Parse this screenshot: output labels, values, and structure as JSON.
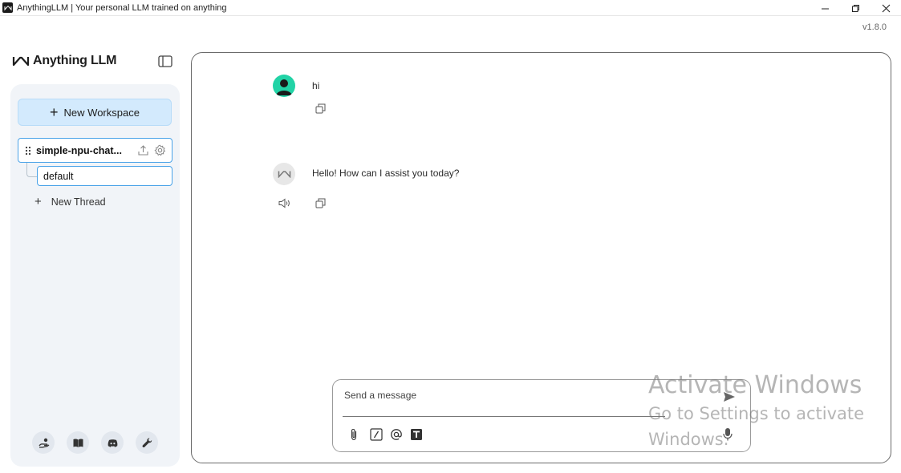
{
  "window": {
    "title": "AnythingLLM | Your personal LLM trained on anything",
    "version": "v1.8.0"
  },
  "brand": {
    "name": "Anything LLM"
  },
  "sidebar": {
    "new_workspace_label": "New Workspace",
    "workspace": {
      "name": "simple-npu-chat..."
    },
    "threads": [
      {
        "label": "default"
      }
    ],
    "new_thread_label": "New Thread",
    "footer_icons": [
      "community-hub-icon",
      "docs-book-icon",
      "discord-icon",
      "settings-wrench-icon"
    ]
  },
  "chat": {
    "messages": [
      {
        "role": "user",
        "text": "hi"
      },
      {
        "role": "assistant",
        "text": "Hello! How can I assist you today?"
      }
    ]
  },
  "composer": {
    "placeholder": "Send a message",
    "tools": [
      "attach-icon",
      "slash-command-icon",
      "mention-icon",
      "text-size-icon"
    ]
  },
  "watermark": {
    "title": "Activate Windows",
    "subtitle_line1": "Go to Settings to activate",
    "subtitle_line2": "Windows."
  },
  "colors": {
    "accent_blue": "#4aa3e8",
    "new_workspace_bg": "#d3eafd",
    "user_avatar": "#22d3a6",
    "sidebar_bg": "#f1f4f8"
  }
}
